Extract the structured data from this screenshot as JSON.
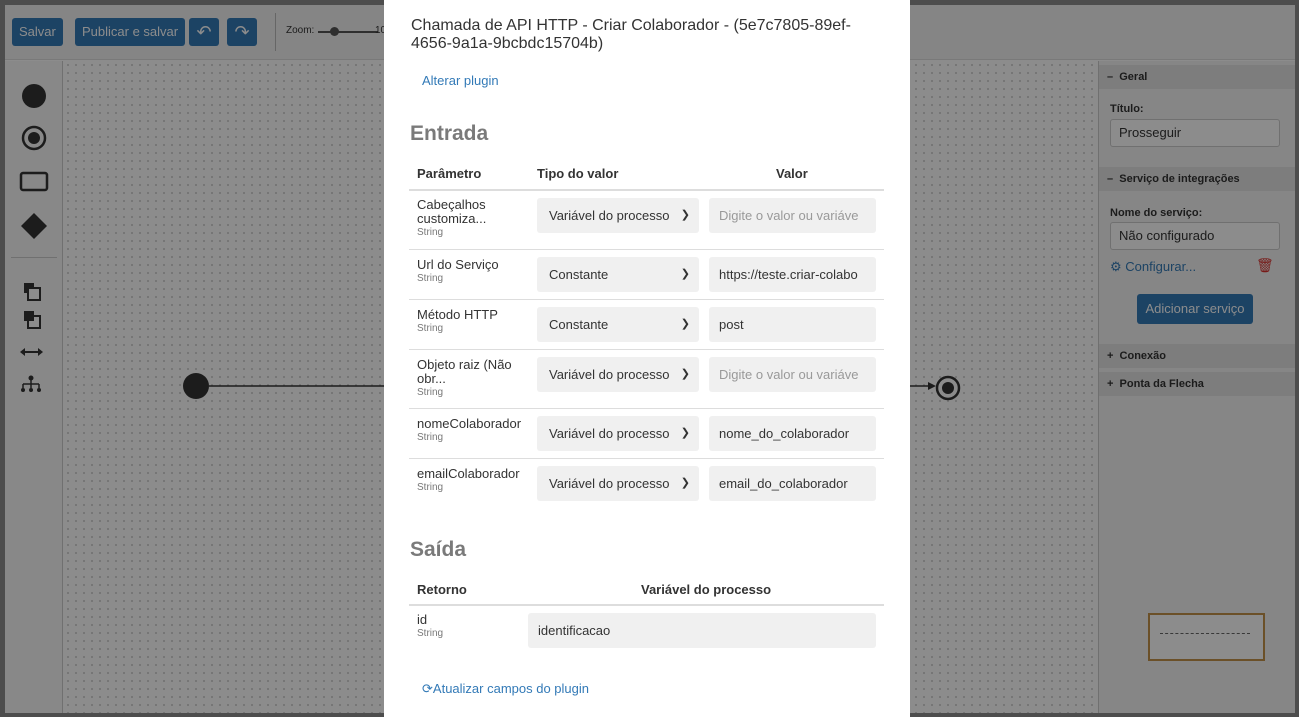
{
  "toolbar": {
    "save_label": "Salvar",
    "publish_label": "Publicar e salvar",
    "zoom_label": "Zoom:",
    "zoom_value": "10"
  },
  "properties": {
    "general_header": "Geral",
    "title_label": "Título:",
    "title_value": "Prosseguir",
    "integrations_header": "Serviço de integrações",
    "service_name_label": "Nome do serviço:",
    "service_name_value": "Não configurado",
    "configure_label": "Configurar...",
    "add_service_label": "Adicionar serviço",
    "connection_header": "Conexão",
    "arrowhead_header": "Ponta da Flecha"
  },
  "modal": {
    "title": "Chamada de API HTTP - Criar Colaborador - (5e7c7805-89ef-4656-9a1a-9bcbdc15704b)",
    "change_plugin": "Alterar plugin",
    "input_heading": "Entrada",
    "input_columns": {
      "param": "Parâmetro",
      "type": "Tipo do valor",
      "value": "Valor"
    },
    "input_rows": [
      {
        "name": "Cabeçalhos customiza...",
        "type": "String",
        "value_type": "Variável do processo",
        "value": "Digite o valor ou variáve",
        "placeholder": true
      },
      {
        "name": "Url do Serviço",
        "type": "String",
        "value_type": "Constante",
        "value": "https://teste.criar-colabo",
        "placeholder": false
      },
      {
        "name": "Método HTTP",
        "type": "String",
        "value_type": "Constante",
        "value": "post",
        "placeholder": false
      },
      {
        "name": "Objeto raiz (Não obr...",
        "type": "String",
        "value_type": "Variável do processo",
        "value": "Digite o valor ou variáve",
        "placeholder": true
      },
      {
        "name": "nomeColaborador",
        "type": "String",
        "value_type": "Variável do processo",
        "value": "nome_do_colaborador",
        "placeholder": false
      },
      {
        "name": "emailColaborador",
        "type": "String",
        "value_type": "Variável do processo",
        "value": "email_do_colaborador",
        "placeholder": false
      }
    ],
    "output_heading": "Saída",
    "output_columns": {
      "return": "Retorno",
      "variable": "Variável do processo"
    },
    "output_rows": [
      {
        "name": "id",
        "type": "String",
        "value": "identificacao"
      }
    ],
    "refresh_label": "Atualizar campos do plugin"
  }
}
